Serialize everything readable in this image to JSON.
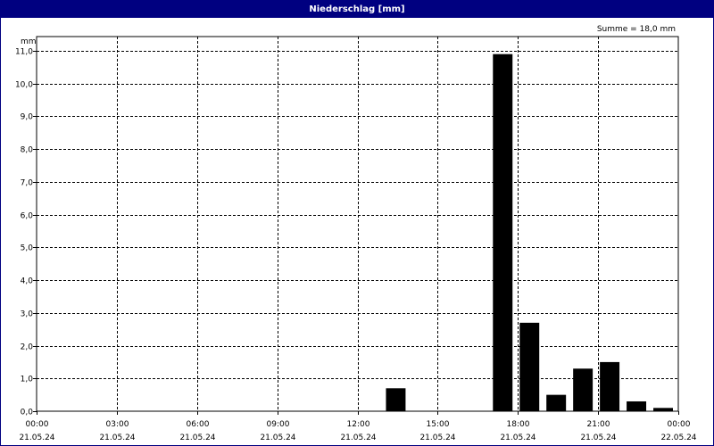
{
  "window": {
    "title": "Niederschlag [mm]"
  },
  "chart_data": {
    "type": "bar",
    "title": "Niederschlag [mm]",
    "ylabel": "mm",
    "annotation": "Summe = 18,0 mm",
    "ylim": [
      0,
      11.0
    ],
    "xlim_hours": [
      0,
      24
    ],
    "grid": true,
    "yticks": [
      "0,0",
      "1,0",
      "2,0",
      "3,0",
      "4,0",
      "5,0",
      "6,0",
      "7,0",
      "8,0",
      "9,0",
      "10,0",
      "11,0"
    ],
    "xticks": [
      {
        "time": "00:00",
        "date": "21.05.24"
      },
      {
        "time": "03:00",
        "date": "21.05.24"
      },
      {
        "time": "06:00",
        "date": "21.05.24"
      },
      {
        "time": "09:00",
        "date": "21.05.24"
      },
      {
        "time": "12:00",
        "date": "21.05.24"
      },
      {
        "time": "15:00",
        "date": "21.05.24"
      },
      {
        "time": "18:00",
        "date": "21.05.24"
      },
      {
        "time": "21:00",
        "date": "21.05.24"
      },
      {
        "time": "00:00",
        "date": "22.05.24"
      }
    ],
    "bars": [
      {
        "start": "13:00",
        "end": "14:00",
        "value": 0.7
      },
      {
        "start": "17:00",
        "end": "18:00",
        "value": 10.9
      },
      {
        "start": "18:00",
        "end": "19:00",
        "value": 2.7
      },
      {
        "start": "19:00",
        "end": "20:00",
        "value": 0.5
      },
      {
        "start": "20:00",
        "end": "21:00",
        "value": 1.3
      },
      {
        "start": "21:00",
        "end": "22:00",
        "value": 1.5
      },
      {
        "start": "22:00",
        "end": "23:00",
        "value": 0.3
      },
      {
        "start": "23:00",
        "end": "24:00",
        "value": 0.1
      }
    ],
    "bar_color": "#000000",
    "grid_color": "#000000"
  }
}
